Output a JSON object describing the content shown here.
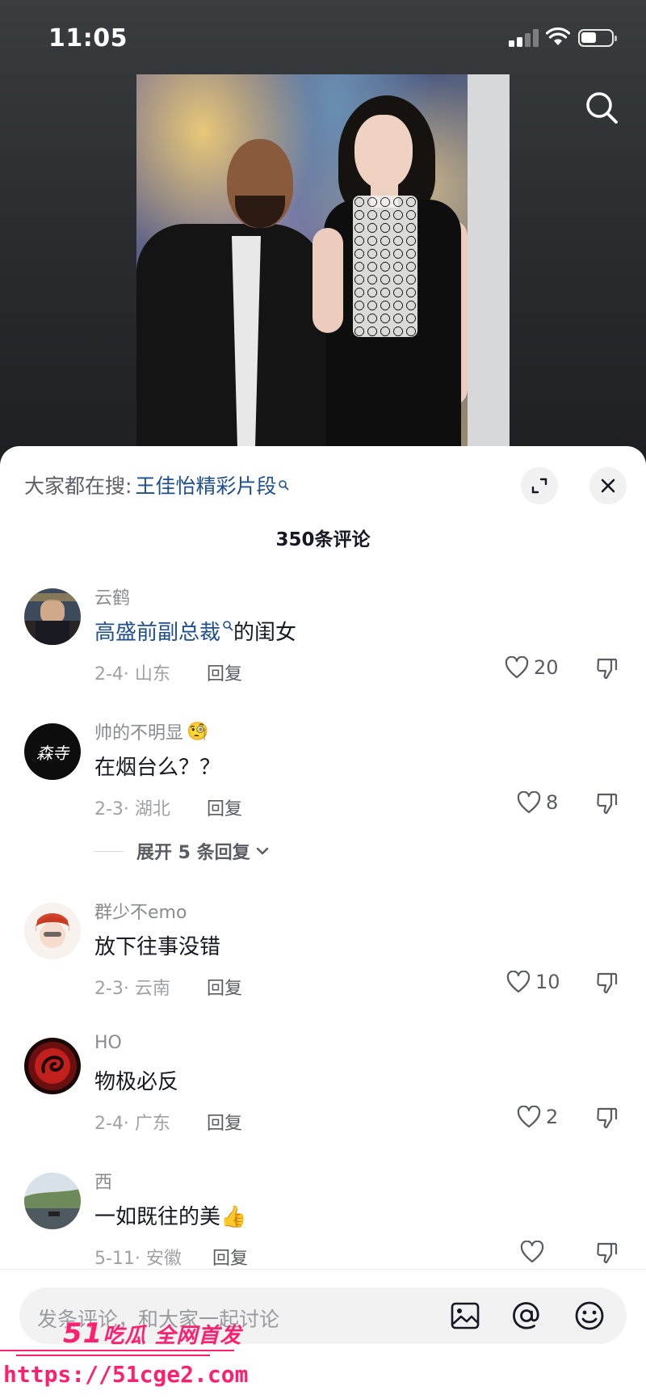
{
  "status_bar": {
    "time": "11:05",
    "icons": [
      "signal-icon",
      "wifi-icon",
      "battery-icon"
    ]
  },
  "top": {
    "search_icon": "search-icon"
  },
  "sheet": {
    "trending_prefix": "大家都在搜:",
    "trending_query": "王佳怡精彩片段",
    "comment_count": "350条评论",
    "expand_icon": "expand-icon",
    "close_icon": "close-icon"
  },
  "comments": [
    {
      "username": "云鹤",
      "text_link": "高盛前副总裁",
      "text": "的闺女",
      "date_location": "2-4· 山东",
      "reply_label": "回复",
      "likes": "20"
    },
    {
      "username": "帅的不明显",
      "username_emoji": "🧐",
      "text": "在烟台么？？",
      "date_location": "2-3· 湖北",
      "reply_label": "回复",
      "likes": "8",
      "expand_replies": "展开 5 条回复"
    },
    {
      "username": "群少不emo",
      "text": "放下往事没错",
      "date_location": "2-3· 云南",
      "reply_label": "回复",
      "likes": "10"
    },
    {
      "username": "HO",
      "text": "物极必反",
      "date_location": "2-4· 广东",
      "reply_label": "回复",
      "likes": "2"
    },
    {
      "username": "西",
      "text": "一如既往的美👍",
      "date_location": "5-11· 安徽",
      "reply_label": "回复",
      "likes": ""
    }
  ],
  "input": {
    "placeholder": "发条评论，和大家一起讨论",
    "icons": [
      "image-icon",
      "mention-icon",
      "emoji-icon"
    ]
  },
  "watermark": {
    "brand_num": "51",
    "brand_text": "吃瓜 全网首发",
    "url": "https://51cge2.com"
  },
  "colors": {
    "link": "#1f4f8f",
    "watermark": "#ff1f6f"
  }
}
